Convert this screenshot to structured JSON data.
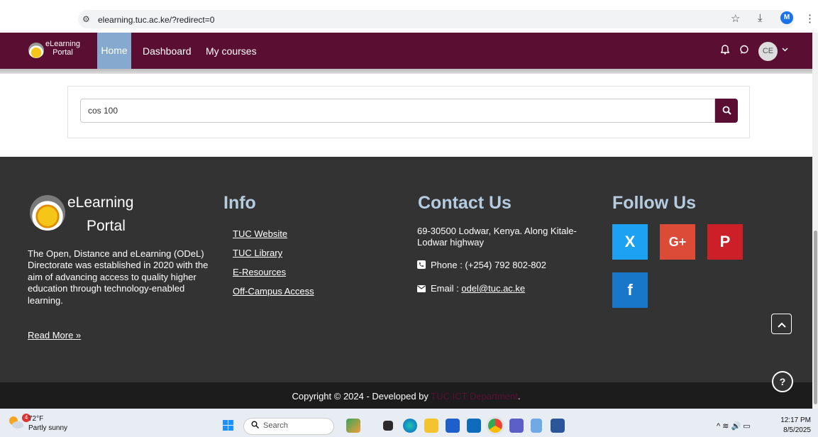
{
  "browser": {
    "url": "elearning.tuc.ac.ke/?redirect=0",
    "profile_initial": "M",
    "back": "←",
    "forward": "→",
    "reload": "C",
    "tune": "⚙",
    "star": "☆",
    "download": "⤓",
    "menu": "⋮"
  },
  "navbar": {
    "brand_line1": "eLearning",
    "brand_line2": "Portal",
    "links": [
      "Home",
      "Dashboard",
      "My courses"
    ],
    "avatar_initials": "CE",
    "bell": "🔔",
    "chat": "💬",
    "caret": "⌄"
  },
  "search": {
    "value": "cos 100",
    "button_icon": "🔍"
  },
  "footer": {
    "brand_line1": "eLearning",
    "brand_line2": "Portal",
    "about": "The Open, Distance and eLearning (ODeL) Directorate was established in 2020 with the aim of advancing access to quality higher education through technology-enabled learning.",
    "read_more": "Read More »",
    "info_heading": "Info",
    "info_links": [
      "TUC Website",
      "TUC Library",
      "E-Resources",
      "Off-Campus Access"
    ],
    "contact_heading": "Contact Us",
    "address": "69-30500 Lodwar, Kenya. Along Kitale-Lodwar highway",
    "phone": "Phone : (+254) 792 802-802",
    "email_label": "Email : ",
    "email": "odel@tuc.ac.ke",
    "follow_heading": "Follow Us",
    "social": {
      "x": "X",
      "google": "G+",
      "pinterest": "P",
      "facebook": "f"
    },
    "colors": {
      "x": "#1da1f2",
      "google": "#dc4a38",
      "pinterest": "#cb2027",
      "facebook": "#1877c9"
    },
    "copyright_prefix": "Copyright © 2024 - Developed by ",
    "copyright_link": "TUC ICT Department",
    "copyright_suffix": ".",
    "to_top": "^",
    "help": "?"
  },
  "taskbar": {
    "temp": "72°F",
    "weather": "Partly sunny",
    "weather_badge": "4",
    "search_placeholder": "Search",
    "time": "12:17 PM",
    "date": "8/5/2025",
    "tray": "^  ≋ 🔊 ▭"
  },
  "colors": {
    "brand": "#5a0f32",
    "active_tab": "#85a9cf",
    "footer_bg": "#333333",
    "footer_heading": "#b5cbe0"
  }
}
